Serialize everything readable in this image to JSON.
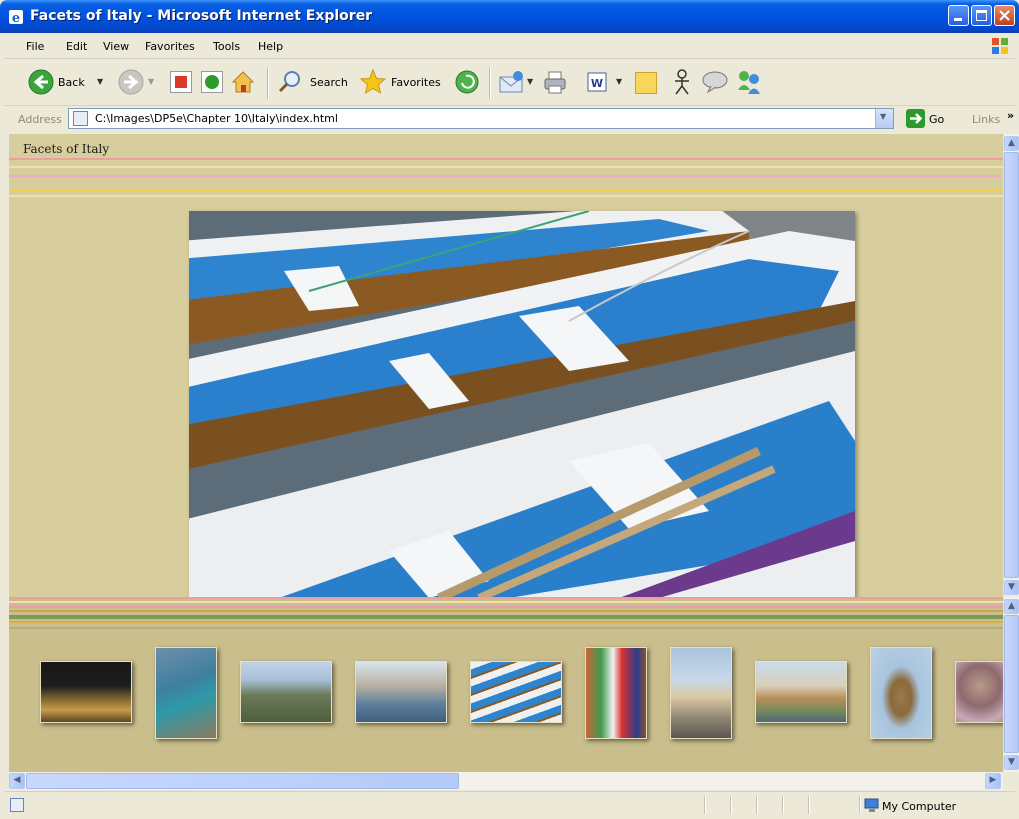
{
  "window": {
    "title": "Facets of Italy - Microsoft Internet Explorer"
  },
  "menu": {
    "items": [
      "File",
      "Edit",
      "View",
      "Favorites",
      "Tools",
      "Help"
    ]
  },
  "toolbar": {
    "back_label": "Back",
    "search_label": "Search",
    "favorites_label": "Favorites"
  },
  "address": {
    "label": "Address",
    "value": "C:\\Images\\DP5e\\Chapter 10\\Italy\\index.html",
    "go_label": "Go",
    "links_label": "Links"
  },
  "page": {
    "site_title": "Facets of Italy"
  },
  "status": {
    "zone": "My Computer"
  },
  "colors": {
    "page_bg": "#D7CD9D",
    "thumb_frame_bg": "#C9BE8C",
    "titlebar": "#0054E3"
  },
  "thumbnails": [
    {
      "name": "monument-at-night"
    },
    {
      "name": "coastal-cliffs"
    },
    {
      "name": "island-village"
    },
    {
      "name": "harbor-boats"
    },
    {
      "name": "rowboats"
    },
    {
      "name": "italian-flag"
    },
    {
      "name": "st-peters-square"
    },
    {
      "name": "castel-sant-angelo"
    },
    {
      "name": "angel-statue"
    },
    {
      "name": "market-produce"
    }
  ]
}
